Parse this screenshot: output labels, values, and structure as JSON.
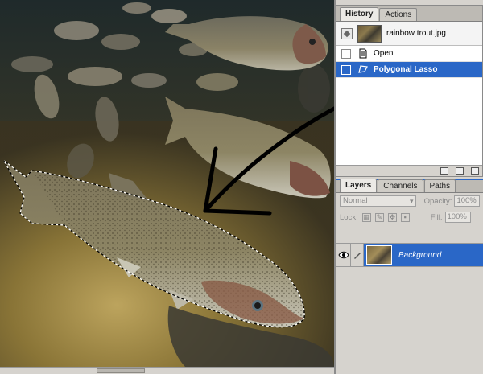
{
  "history_panel": {
    "tabs": [
      {
        "label": "History",
        "active": true
      },
      {
        "label": "Actions",
        "active": false
      }
    ],
    "snapshot": {
      "name": "rainbow trout.jpg"
    },
    "states": [
      {
        "label": "Open",
        "selected": false,
        "icon": "document-icon"
      },
      {
        "label": "Polygonal Lasso",
        "selected": true,
        "icon": "polygonal-lasso-icon"
      }
    ]
  },
  "layers_panel": {
    "tabs": [
      {
        "label": "Layers",
        "active": true
      },
      {
        "label": "Channels",
        "active": false
      },
      {
        "label": "Paths",
        "active": false
      }
    ],
    "blend_mode": "Normal",
    "opacity_label": "Opacity:",
    "opacity_value": "100%",
    "lock_label": "Lock:",
    "fill_label": "Fill:",
    "fill_value": "100%",
    "layers": [
      {
        "name": "Background",
        "visible": true,
        "selected": true
      }
    ]
  },
  "colors": {
    "selection_blue": "#2a67c7",
    "panel_gray": "#d6d3ce",
    "annotation_arrow": "#000000"
  }
}
